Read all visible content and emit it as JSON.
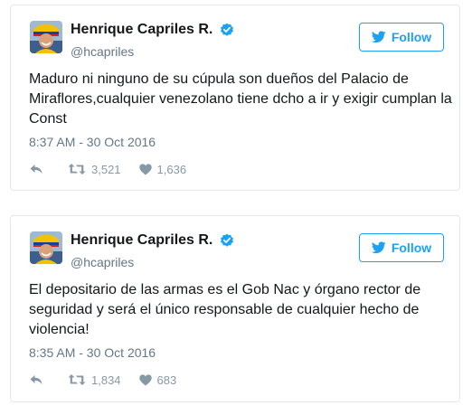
{
  "tweets": [
    {
      "name": "Henrique Capriles R.",
      "handle": "@hcapriles",
      "follow_label": "Follow",
      "text": "Maduro ni ninguno de su cúpula son dueños del Palacio de Miraflores,cualquier venezolano tiene dcho a ir y exigir cumplan la Const",
      "timestamp": "8:37 AM - 30 Oct 2016",
      "retweets": "3,521",
      "likes": "1,636"
    },
    {
      "name": "Henrique Capriles R.",
      "handle": "@hcapriles",
      "follow_label": "Follow",
      "text": "El depositario de las armas es el Gob Nac y órgano rector de seguridad y será el único responsable de cualquier hecho de violencia!",
      "timestamp": "8:35 AM - 30 Oct 2016",
      "retweets": "1,834",
      "likes": "683"
    }
  ],
  "icons": {
    "verified": "verified-badge-icon",
    "bird": "twitter-bird-icon",
    "reply": "reply-icon",
    "retweet": "retweet-icon",
    "like": "heart-icon"
  },
  "colors": {
    "accent": "#1da1f2",
    "muted": "#657786",
    "action": "#8899a6",
    "border": "#e1e8ed"
  }
}
